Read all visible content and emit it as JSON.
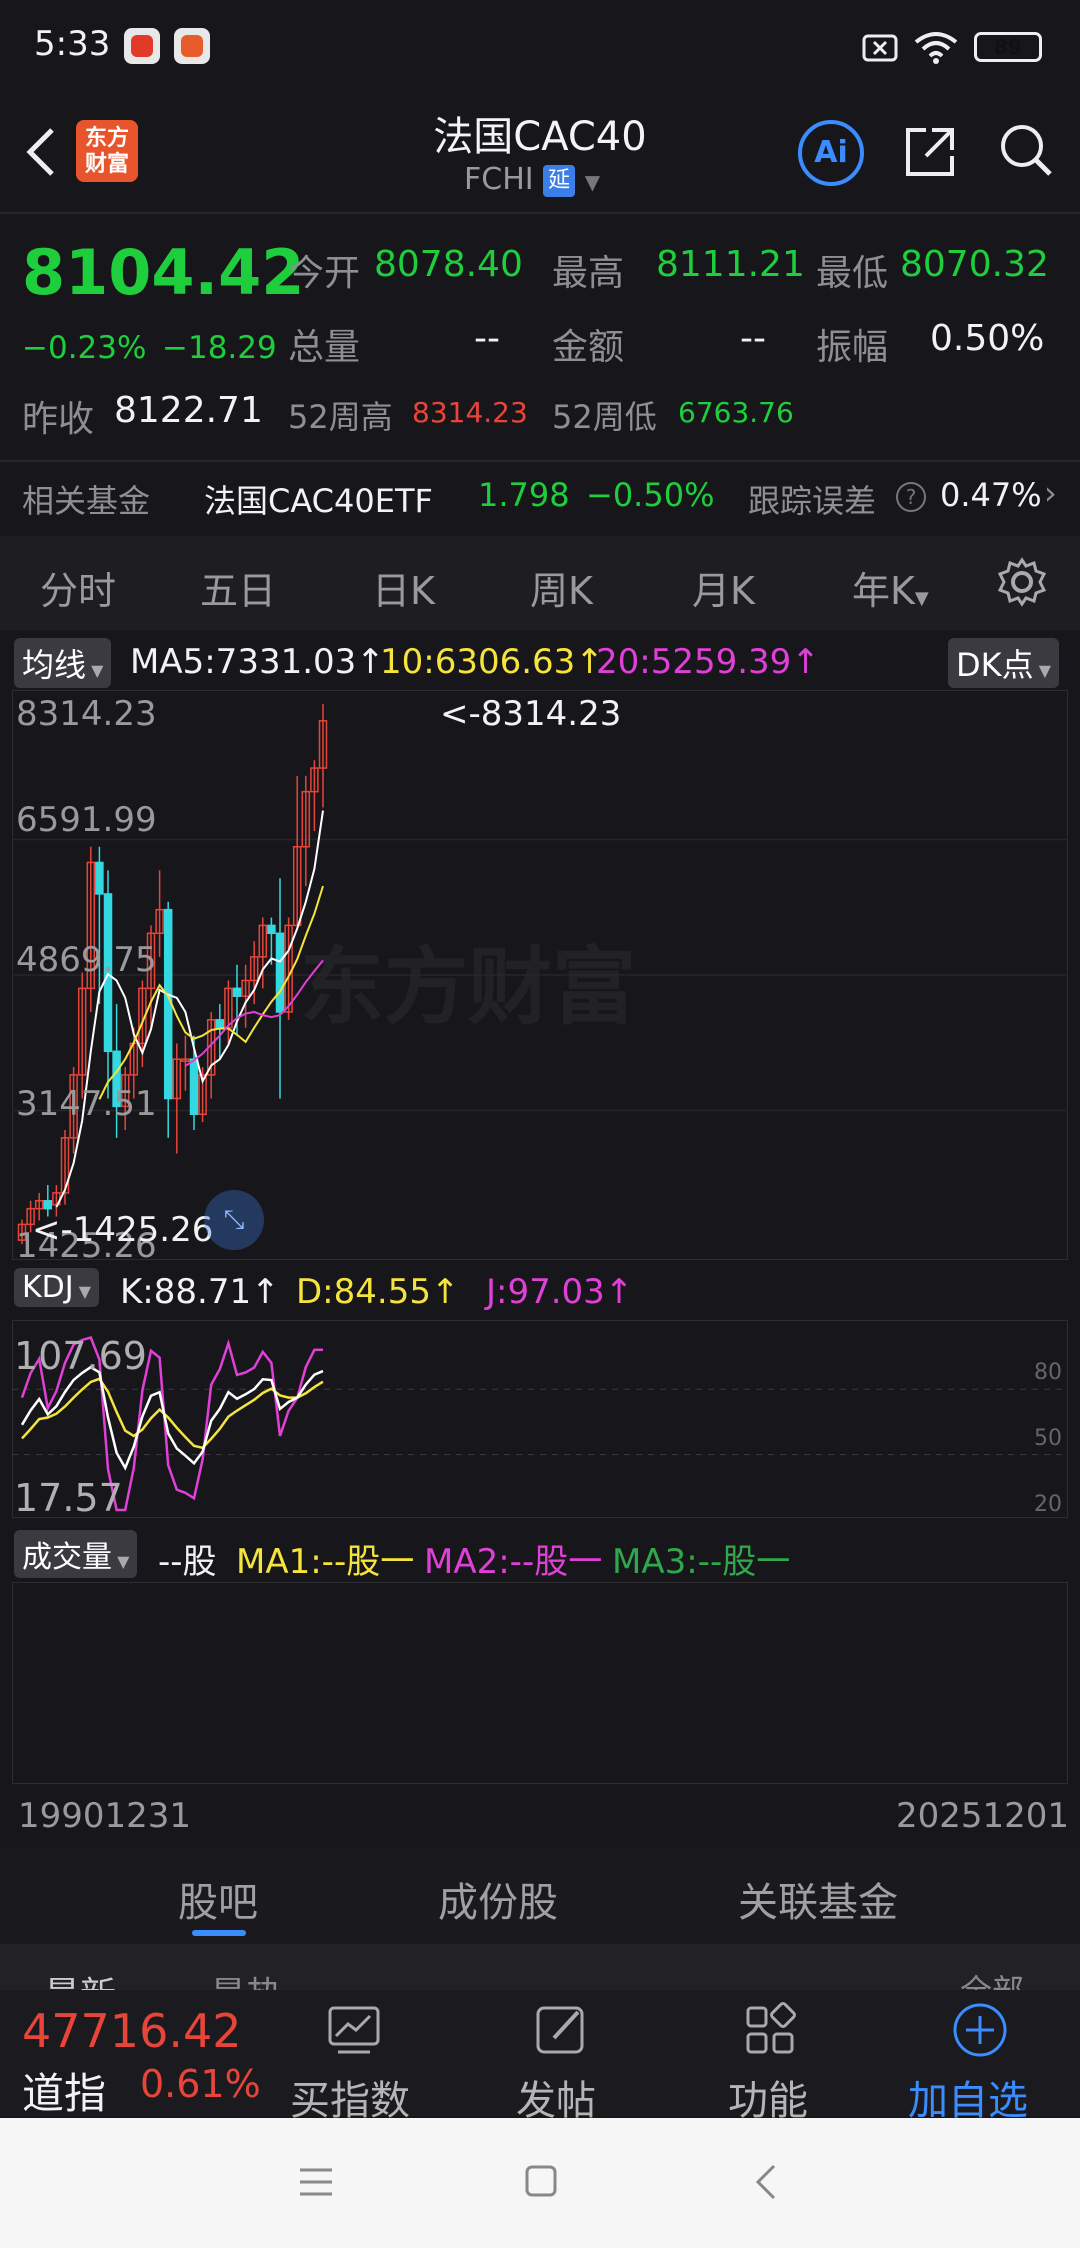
{
  "status": {
    "time": "5:33",
    "battery": "89"
  },
  "header": {
    "logo_text": "东方\n财富",
    "title": "法国CAC40",
    "code": "FCHI",
    "delay_badge": "延",
    "ai_label": "Ai"
  },
  "quote": {
    "price": "8104.42",
    "change_pct": "−0.23%",
    "change": "−18.29",
    "open_label": "今开",
    "open": "8078.40",
    "high_label": "最高",
    "high": "8111.21",
    "low_label": "最低",
    "low": "8070.32",
    "volume_label": "总量",
    "volume": "--",
    "amount_label": "金额",
    "amount": "--",
    "amplitude_label": "振幅",
    "amplitude": "0.50%",
    "prev_label": "昨收",
    "prev": "8122.71",
    "w52h_label": "52周高",
    "w52h": "8314.23",
    "w52l_label": "52周低",
    "w52l": "6763.76"
  },
  "fund": {
    "label": "相关基金",
    "name": "法国CAC40ETF",
    "price": "1.798",
    "pct": "−0.50%",
    "track_label": "跟踪误差",
    "track": "0.47%"
  },
  "period_tabs": [
    "分时",
    "五日",
    "日K",
    "周K",
    "月K",
    "年K"
  ],
  "ma": {
    "pill": "均线",
    "ma5": "MA5:7331.03",
    "ma10": "10:6306.63",
    "ma20": "20:5259.39",
    "arrow": "↑",
    "dk": "DK点"
  },
  "main_axis": {
    "labels": [
      "8314.23",
      "6591.99",
      "4869.75",
      "3147.51",
      "1425.26"
    ],
    "max_note": "<-8314.23",
    "min_note": "<-1425.26"
  },
  "kdj": {
    "pill": "KDJ",
    "k": "K:88.71",
    "d": "D:84.55",
    "j": "J:97.03",
    "arrow": "↑",
    "top": "107.69",
    "bottom": "17.57",
    "ticks": [
      "80",
      "50",
      "20"
    ]
  },
  "vol": {
    "pill": "成交量",
    "unit": "--股",
    "ma1": "MA1:--股一",
    "ma2": "MA2:--股一",
    "ma3": "MA3:--股一"
  },
  "dates": {
    "start": "19901231",
    "end": "20251201"
  },
  "bottom_tabs": [
    "股吧",
    "成份股",
    "关联基金"
  ],
  "peek": {
    "left": "最新",
    "mid": "最热",
    "right": "全部"
  },
  "dock": {
    "index_price": "47716.42",
    "index_name": "道指",
    "index_pct": "0.61%",
    "b1": "买指数",
    "b2": "发帖",
    "b3": "功能",
    "b4": "加自选"
  },
  "watermark": "东方财富",
  "colors": {
    "up": "#e8453a",
    "down": "#1fce3c",
    "accent": "#3b8dff",
    "ma5": "#ffffff",
    "ma10": "#f5e43c",
    "ma20": "#e040d8"
  },
  "chart_data": {
    "type": "candlestick",
    "title": "法国CAC40 年K",
    "x_start": "19901231",
    "x_end": "20251201",
    "ylim": [
      1425.26,
      8314.23
    ],
    "candles": [
      [
        1500,
        1700,
        1450,
        1760
      ],
      [
        1700,
        1900,
        1600,
        2000
      ],
      [
        1900,
        2000,
        1750,
        2100
      ],
      [
        2000,
        1900,
        1800,
        2200
      ],
      [
        1950,
        2100,
        1800,
        2200
      ],
      [
        2100,
        2800,
        1950,
        2900
      ],
      [
        2800,
        3600,
        2600,
        3700
      ],
      [
        3600,
        4700,
        3300,
        4900
      ],
      [
        4700,
        6300,
        4400,
        6500
      ],
      [
        6300,
        5900,
        4500,
        6500
      ],
      [
        5900,
        3900,
        3300,
        6200
      ],
      [
        3900,
        3200,
        2800,
        4500
      ],
      [
        3200,
        3600,
        2900,
        3700
      ],
      [
        3600,
        4000,
        3300,
        4200
      ],
      [
        4000,
        4700,
        3700,
        4800
      ],
      [
        4700,
        5400,
        4200,
        5500
      ],
      [
        5400,
        5700,
        5100,
        6200
      ],
      [
        5700,
        3300,
        2800,
        5800
      ],
      [
        3300,
        3800,
        2600,
        4000
      ],
      [
        3800,
        3800,
        3400,
        4100
      ],
      [
        3800,
        3100,
        2900,
        4100
      ],
      [
        3100,
        3600,
        3000,
        3700
      ],
      [
        3600,
        4300,
        3300,
        4400
      ],
      [
        4300,
        4200,
        3800,
        4500
      ],
      [
        4200,
        4700,
        4000,
        4800
      ],
      [
        4700,
        4600,
        4100,
        5000
      ],
      [
        4600,
        4800,
        4200,
        5000
      ],
      [
        4800,
        5100,
        4500,
        5300
      ],
      [
        5100,
        5500,
        4700,
        5600
      ],
      [
        5500,
        5400,
        5000,
        5600
      ],
      [
        5400,
        4400,
        3300,
        6100
      ],
      [
        4400,
        5500,
        4300,
        5600
      ],
      [
        5500,
        6500,
        5500,
        7400
      ],
      [
        6500,
        7200,
        6000,
        7400
      ],
      [
        7200,
        7500,
        6700,
        7600
      ],
      [
        7500,
        8100,
        7000,
        8314
      ]
    ],
    "kdj_range": [
      17.57,
      107.69
    ]
  }
}
